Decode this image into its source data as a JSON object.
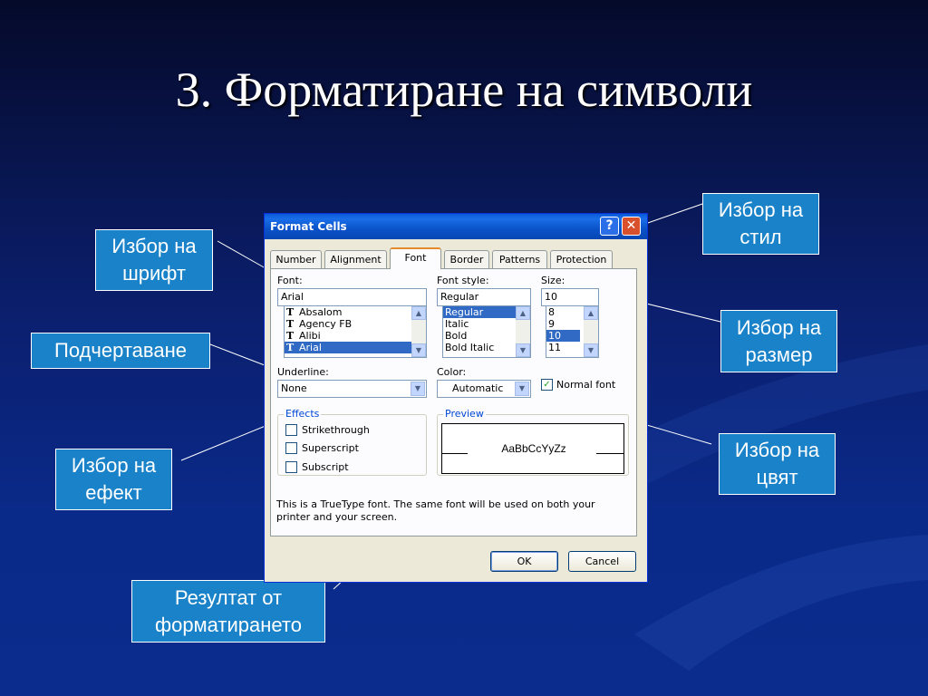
{
  "slide": {
    "title": "3. Форматиране на символи"
  },
  "callouts": {
    "font": "Избор на шрифт",
    "style": "Избор на стил",
    "underline": "Подчертаване",
    "size": "Избор на размер",
    "effect": "Избор на ефект",
    "color": "Избор на цвят",
    "result": "Резултат от форматирането"
  },
  "dialog": {
    "title": "Format Cells",
    "help_glyph": "?",
    "close_glyph": "✕",
    "tabs": [
      "Number",
      "Alignment",
      "Font",
      "Border",
      "Patterns",
      "Protection"
    ],
    "active_tab": "Font",
    "font": {
      "label": "Font:",
      "value": "Arial",
      "items": [
        "Absalom",
        "Agency FB",
        "Alibi",
        "Arial"
      ],
      "selected": "Arial"
    },
    "font_style": {
      "label": "Font style:",
      "value": "Regular",
      "items": [
        "Regular",
        "Italic",
        "Bold",
        "Bold Italic"
      ],
      "selected": "Regular"
    },
    "size": {
      "label": "Size:",
      "value": "10",
      "items": [
        "8",
        "9",
        "10",
        "11"
      ],
      "selected": "10"
    },
    "underline": {
      "label": "Underline:",
      "value": "None"
    },
    "color": {
      "label": "Color:",
      "value": "Automatic"
    },
    "normal_font": {
      "label": "Normal font",
      "checked": true
    },
    "effects": {
      "title": "Effects",
      "items": [
        {
          "label": "Strikethrough",
          "checked": false
        },
        {
          "label": "Superscript",
          "checked": false
        },
        {
          "label": "Subscript",
          "checked": false
        }
      ]
    },
    "preview": {
      "title": "Preview",
      "sample": "AaBbCcYyZz"
    },
    "note": "This is a TrueType font.  The same font will be used on both your printer and your screen.",
    "ok_label": "OK",
    "cancel_label": "Cancel"
  },
  "colors": {
    "callout_bg": "#1a82c8",
    "titlebar": "#0a52c8",
    "selection": "#316ac5"
  }
}
